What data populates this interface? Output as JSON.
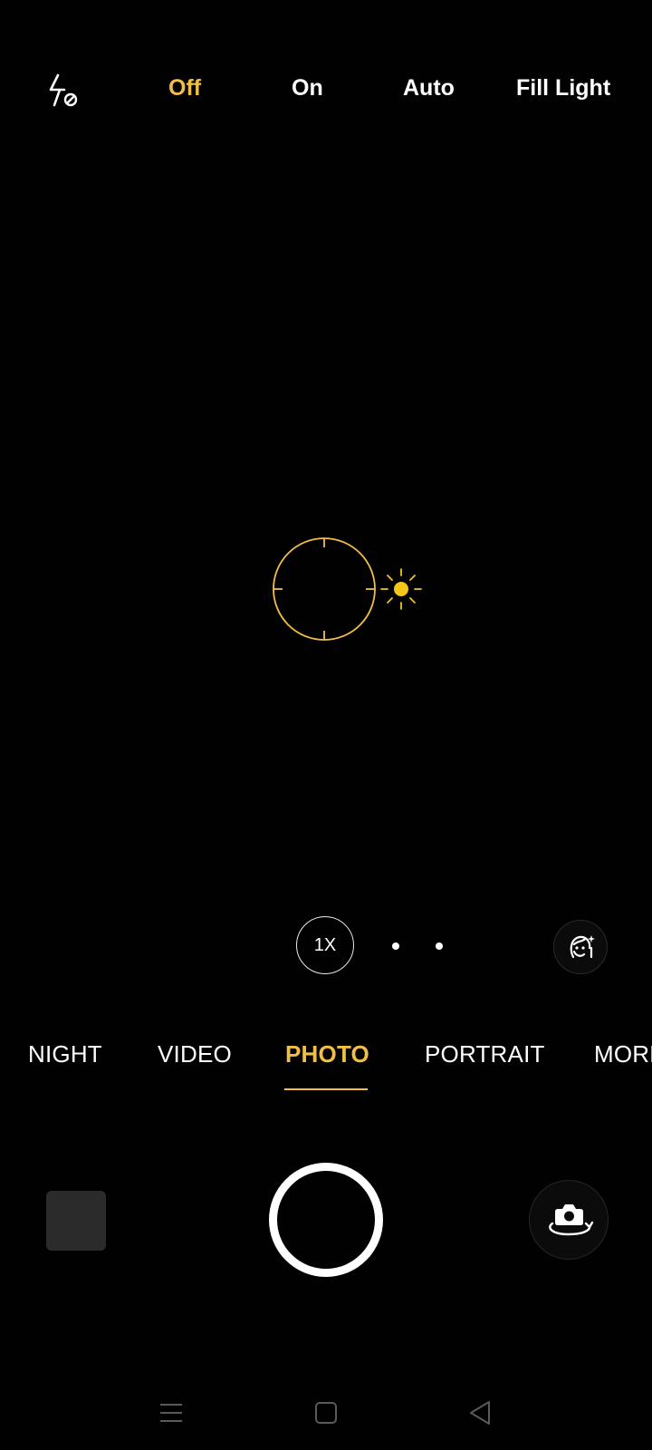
{
  "flash": {
    "icon": "flash-off-icon",
    "options": [
      {
        "label": "Off",
        "active": true
      },
      {
        "label": "On",
        "active": false
      },
      {
        "label": "Auto",
        "active": false
      },
      {
        "label": "Fill Light",
        "active": false
      }
    ]
  },
  "focus": {
    "icon": "focus-ring-icon",
    "exposure_icon": "sun-exposure-icon",
    "color": "#f2bf45"
  },
  "zoom": {
    "current": "1X",
    "dots": 2
  },
  "beauty": {
    "icon": "face-beauty-icon"
  },
  "modes": {
    "items": [
      {
        "label": "NIGHT"
      },
      {
        "label": "VIDEO"
      },
      {
        "label": "PHOTO",
        "active": true
      },
      {
        "label": "PORTRAIT"
      },
      {
        "label": "MORE"
      }
    ]
  },
  "controls": {
    "gallery_icon": "gallery-thumbnail",
    "shutter_icon": "shutter-button",
    "switch_icon": "switch-camera-icon"
  },
  "nav": {
    "icons": [
      "menu-icon",
      "home-icon",
      "back-icon"
    ]
  },
  "colors": {
    "accent": "#f2bf45",
    "background": "#010101",
    "text": "#ffffff"
  }
}
